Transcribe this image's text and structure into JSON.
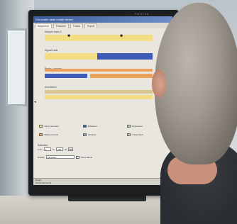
{
  "monitor": {
    "brand": "FUJITSU"
  },
  "app": {
    "title": "Chromatin state model viewer",
    "tabs": [
      "Sequence",
      "Features",
      "Tracks",
      "Export"
    ]
  },
  "tracks": [
    {
      "label": "Sample track A"
    },
    {
      "label": "Signal track"
    },
    {
      "label": "Peaks / regions"
    },
    {
      "label": "Annotation"
    }
  ],
  "legend": [
    {
      "label": "Active promoter",
      "color": "#f2dd85"
    },
    {
      "label": "Weak promoter",
      "color": "#e9a35c"
    },
    {
      "label": "Enhancer",
      "color": "#3f5bb8"
    },
    {
      "label": "Insulator",
      "color": "#9fb0c8"
    },
    {
      "label": "Repressed",
      "color": "#a5d08a"
    },
    {
      "label": "Transcribed",
      "color": "#d8c58f"
    }
  ],
  "controls": {
    "group_title": "Selection",
    "from_label": "From",
    "to_label": "To",
    "from_value": "1",
    "to_value": "100",
    "unit_label": "kb",
    "go_label": "Go",
    "display_label": "Display",
    "display_value": "All states",
    "checkbox_label": "Show labels"
  },
  "status": {
    "line1": "Ready",
    "line2": "Chromosome 19"
  },
  "colors": {
    "titlebar": "#3a5e9c",
    "yellow": "#f2dd85",
    "blue": "#3f5bb8",
    "orange": "#e9a35c"
  }
}
